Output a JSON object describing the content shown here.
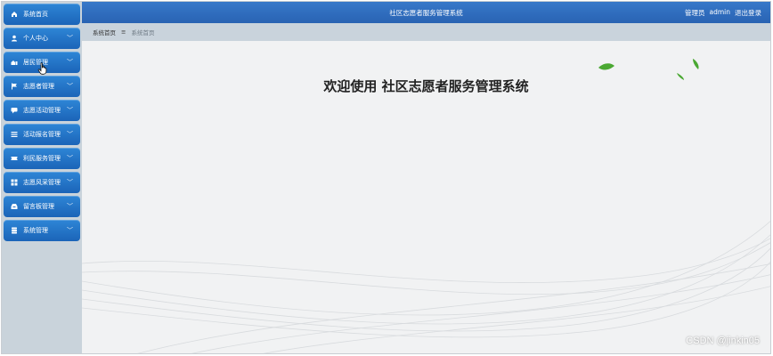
{
  "sidebar": {
    "items": [
      {
        "label": "系统首页",
        "icon": "home-icon",
        "chevron": ""
      },
      {
        "label": "个人中心",
        "icon": "user-icon",
        "chevron": "﹀"
      },
      {
        "label": "居民管理",
        "icon": "residents-icon",
        "chevron": "﹀"
      },
      {
        "label": "志愿者管理",
        "icon": "flag-icon",
        "chevron": "﹀"
      },
      {
        "label": "志愿活动管理",
        "icon": "chat-icon",
        "chevron": "﹀"
      },
      {
        "label": "活动报名管理",
        "icon": "list-icon",
        "chevron": "﹀"
      },
      {
        "label": "利民服务管理",
        "icon": "ticket-icon",
        "chevron": "﹀"
      },
      {
        "label": "志愿风采管理",
        "icon": "grid-icon",
        "chevron": "﹀"
      },
      {
        "label": "留言板管理",
        "icon": "inbox-icon",
        "chevron": "﹀"
      },
      {
        "label": "系统管理",
        "icon": "database-icon",
        "chevron": "﹀"
      }
    ]
  },
  "topbar": {
    "title": "社区志愿者服务管理系统",
    "role": "管理员",
    "username": "admin",
    "logout": "退出登录"
  },
  "breadcrumb": {
    "home": "系统首页",
    "separator": "≡",
    "current": "系统首页"
  },
  "content": {
    "welcome": "欢迎使用 社区志愿者服务管理系统"
  },
  "watermark": "CSDN @jinkin05"
}
